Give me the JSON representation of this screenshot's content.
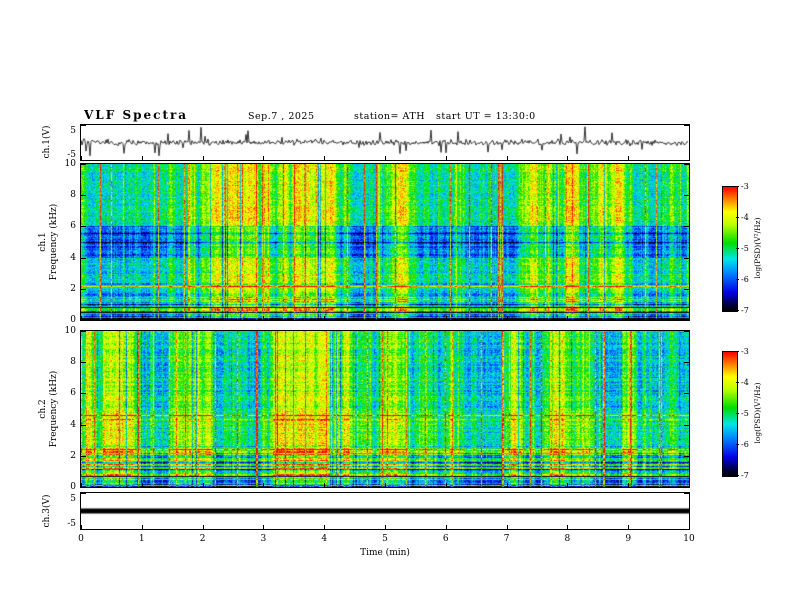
{
  "header": {
    "title": "VLF Spectra",
    "date": "Sep.7 , 2025",
    "station": "station= ATH",
    "start_ut": "start UT =  13:30:0"
  },
  "axes": {
    "time": {
      "label": "Time (min)",
      "min": 0,
      "max": 10,
      "ticks": [
        0,
        1,
        2,
        3,
        4,
        5,
        6,
        7,
        8,
        9,
        10
      ]
    },
    "ch1_wave": {
      "ylabel": "ch.1(V)",
      "ymin": -5,
      "ymax": 5,
      "yticks": [
        5,
        -5
      ]
    },
    "ch1_spec": {
      "ylabel_line1": "ch.1",
      "ylabel_line2": "Frequency (kHz)",
      "ymin": 0,
      "ymax": 10,
      "yticks": [
        0,
        2,
        4,
        6,
        8,
        10
      ]
    },
    "ch2_spec": {
      "ylabel_line1": "ch.2",
      "ylabel_line2": "Frequency (kHz)",
      "ymin": 0,
      "ymax": 10,
      "yticks": [
        0,
        2,
        4,
        6,
        8,
        10
      ]
    },
    "ch3_wave": {
      "ylabel": "ch.3(V)",
      "ymin": -5,
      "ymax": 5,
      "yticks": [
        5,
        -5
      ]
    }
  },
  "colorbar": {
    "label": "log(PSD)(V²/Hz)",
    "ticks": [
      -3,
      -4,
      -5,
      -6,
      -7
    ],
    "min": -7,
    "max": -3,
    "stops": [
      [
        0.0,
        "#000000"
      ],
      [
        0.06,
        "#00004d"
      ],
      [
        0.15,
        "#0000e6"
      ],
      [
        0.3,
        "#0080ff"
      ],
      [
        0.42,
        "#00e6e6"
      ],
      [
        0.55,
        "#00dd00"
      ],
      [
        0.7,
        "#bfff00"
      ],
      [
        0.8,
        "#ffff00"
      ],
      [
        0.9,
        "#ff8000"
      ],
      [
        1.0,
        "#ff0000"
      ]
    ]
  },
  "chart_data": [
    {
      "type": "line",
      "title": "ch.1 time series",
      "xlabel": "Time (min)",
      "ylabel": "ch.1(V)",
      "xlim": [
        0,
        10
      ],
      "ylim": [
        -5,
        5
      ],
      "description": "Dense noisy waveform centered near 0 V with frequent impulsive spikes reaching roughly ±2 to ±4.5 V throughout the full 10-minute record",
      "render": {
        "seed": 4242,
        "noise_amp": 0.85,
        "spike_prob": 0.045,
        "spike_amp_max": 4.1
      }
    },
    {
      "type": "heatmap",
      "title": "ch.1 spectrogram",
      "xlabel": "Time (min)",
      "ylabel": "ch.1 Frequency (kHz)",
      "zlabel": "log(PSD)(V²/Hz)",
      "xlim": [
        0,
        10
      ],
      "ylim": [
        0,
        10
      ],
      "zlim": [
        -7,
        -3
      ],
      "colormap": "jet-like (black/blue low PSD, green mid, yellow/red high PSD)",
      "description": "Broadband impulsive vertical streaks (yellow/red, PSD near -3.5) spanning 0-10 kHz at many times; background mostly green/cyan near -5; depressed blue band (near -6) between about 4 and 6 kHz; narrowband enhancement near 2.2 kHz; dark horizontal lines (near -7) below 1 kHz; banded horizontal structure 1-2.5 kHz",
      "render": {
        "seed": 20250907,
        "bands": [
          {
            "f0": 6,
            "f1": 10,
            "offset": 0.05,
            "rowVar": 0.05
          },
          {
            "f0": 4,
            "f1": 6,
            "offset": -0.13,
            "rowVar": 0.07
          },
          {
            "f0": 2.5,
            "f1": 4,
            "offset": 0.01,
            "rowVar": 0.06
          },
          {
            "f0": 1,
            "f1": 2.5,
            "offset": 0.02,
            "rowVar": 0.2
          },
          {
            "f0": 0,
            "f1": 1,
            "offset": -0.04,
            "rowVar": 0.28
          }
        ],
        "hlines": [
          {
            "f": 2.2,
            "h": 1,
            "delta": 0.22
          },
          {
            "f": 5.0,
            "h": 1,
            "delta": -0.28
          },
          {
            "f": 5.6,
            "h": 1,
            "delta": -0.2
          },
          {
            "f": 0.15,
            "h": 1,
            "delta": -0.5
          },
          {
            "f": 0.5,
            "h": 1,
            "delta": -0.45
          },
          {
            "f": 0.85,
            "h": 1,
            "delta": -0.4
          },
          {
            "f": 0.05,
            "h": 1,
            "delta": -0.5
          }
        ]
      }
    },
    {
      "type": "heatmap",
      "title": "ch.2 spectrogram",
      "xlabel": "Time (min)",
      "ylabel": "ch.2 Frequency (kHz)",
      "zlabel": "log(PSD)(V²/Hz)",
      "xlim": [
        0,
        10
      ],
      "ylim": [
        0,
        10
      ],
      "zlim": [
        -7,
        -3
      ],
      "colormap": "jet-like (black/blue low PSD, green mid, yellow/red high PSD)",
      "description": "Similar broadband vertical streaking as ch.1; brighter green/yellow band between about 2.5 and 5 kHz; persistent narrow red line near 4.6 kHz (PSD near -3.3); strong horizontal banding below 2.5 kHz with several dark (near -7) lines; background green/cyan near -5",
      "render": {
        "seed": 777,
        "bands": [
          {
            "f0": 5,
            "f1": 10,
            "offset": -0.02,
            "rowVar": 0.06
          },
          {
            "f0": 2.6,
            "f1": 5,
            "offset": 0.06,
            "rowVar": 0.08
          },
          {
            "f0": 0,
            "f1": 2.6,
            "offset": 0.02,
            "rowVar": 0.24
          }
        ],
        "hlines": [
          {
            "f": 4.6,
            "h": 1,
            "delta": 0.4
          },
          {
            "f": 4.35,
            "h": 1,
            "delta": 0.18
          },
          {
            "f": 2.45,
            "h": 1,
            "delta": 0.25
          },
          {
            "f": 0.2,
            "h": 1,
            "delta": -0.5
          },
          {
            "f": 0.7,
            "h": 1,
            "delta": -0.45
          },
          {
            "f": 1.15,
            "h": 1,
            "delta": -0.42
          },
          {
            "f": 1.6,
            "h": 1,
            "delta": -0.38
          },
          {
            "f": 2.05,
            "h": 1,
            "delta": -0.3
          },
          {
            "f": 0.05,
            "h": 1,
            "delta": -0.5
          }
        ]
      }
    },
    {
      "type": "line",
      "title": "ch.3 time series",
      "xlabel": "Time (min)",
      "ylabel": "ch.3(V)",
      "xlim": [
        0,
        10
      ],
      "ylim": [
        -5,
        5
      ],
      "values": "constant 0",
      "description": "Flat thick black line at 0 V for the entire 10 minutes (channel flat/no signal)",
      "render": {
        "value": 0,
        "thickness_px": 5
      }
    }
  ]
}
